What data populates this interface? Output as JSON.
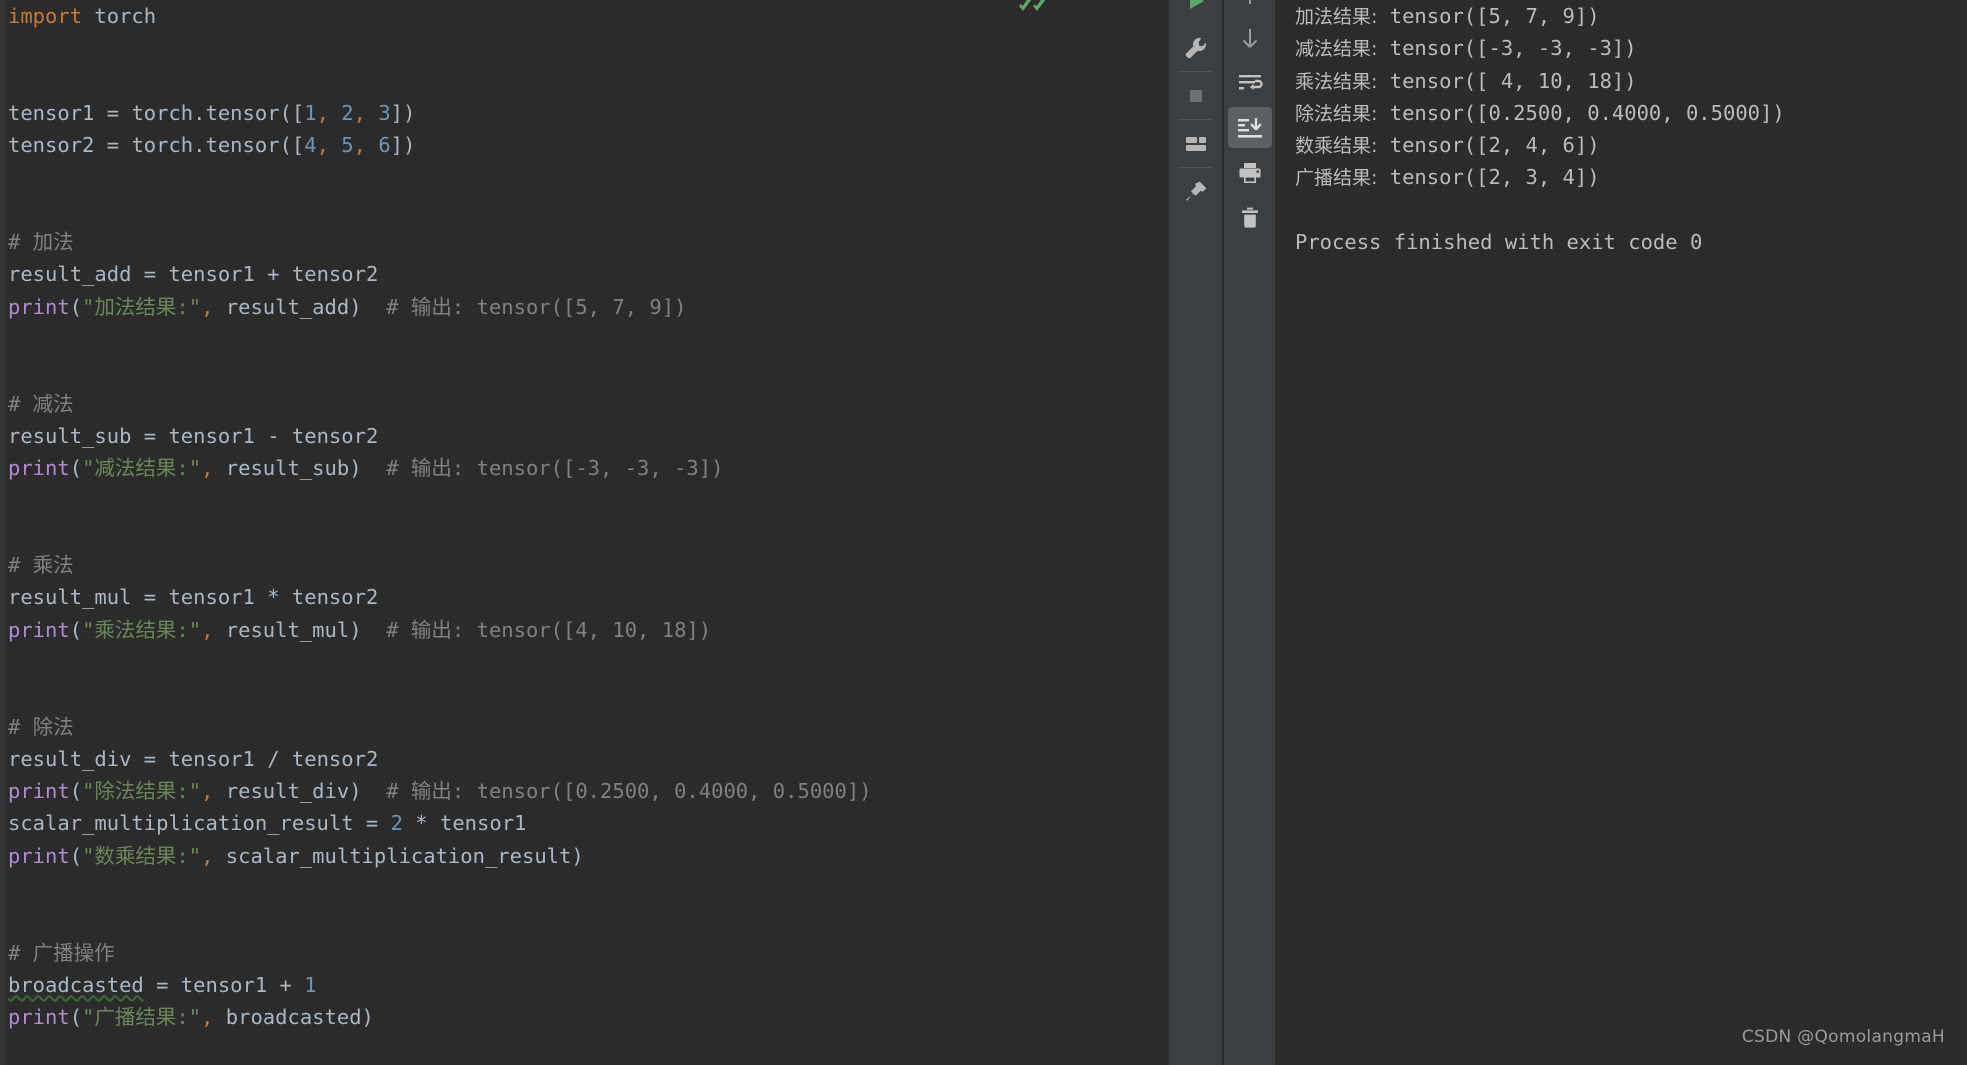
{
  "app": {
    "name": "PyCharm",
    "theme_colors": {
      "editor_background": "#2B2B2B",
      "gutter": "#313335",
      "toolbar_background": "#3C3F41",
      "scrollbar_thumb": "#595959",
      "keyword": "#CC7832",
      "identifier": "#A9B7C6",
      "number": "#6897BB",
      "string": "#6A8759",
      "comment": "#808080",
      "function": "#B389D4",
      "console_text": "#BBBBBB",
      "typo_underline": "#3A6B35",
      "run_green": "#59A869",
      "active_button": "#5B6064"
    }
  },
  "editor": {
    "language": "Python",
    "inspection_status": "ok",
    "lines": [
      [
        {
          "t": "import ",
          "c": "kw"
        },
        {
          "t": "torch",
          "c": "id"
        }
      ],
      [],
      [],
      [
        {
          "t": "tensor1 ",
          "c": "id"
        },
        {
          "t": "= ",
          "c": "pn"
        },
        {
          "t": "torch",
          "c": "id"
        },
        {
          "t": ".",
          "c": "pn"
        },
        {
          "t": "tensor",
          "c": "id"
        },
        {
          "t": "([",
          "c": "pn"
        },
        {
          "t": "1",
          "c": "num"
        },
        {
          "t": ",",
          "c": "cm"
        },
        {
          "t": " ",
          "c": "pn"
        },
        {
          "t": "2",
          "c": "num"
        },
        {
          "t": ",",
          "c": "cm"
        },
        {
          "t": " ",
          "c": "pn"
        },
        {
          "t": "3",
          "c": "num"
        },
        {
          "t": "])",
          "c": "pn"
        }
      ],
      [
        {
          "t": "tensor2 ",
          "c": "id"
        },
        {
          "t": "= ",
          "c": "pn"
        },
        {
          "t": "torch",
          "c": "id"
        },
        {
          "t": ".",
          "c": "pn"
        },
        {
          "t": "tensor",
          "c": "id"
        },
        {
          "t": "([",
          "c": "pn"
        },
        {
          "t": "4",
          "c": "num"
        },
        {
          "t": ",",
          "c": "cm"
        },
        {
          "t": " ",
          "c": "pn"
        },
        {
          "t": "5",
          "c": "num"
        },
        {
          "t": ",",
          "c": "cm"
        },
        {
          "t": " ",
          "c": "pn"
        },
        {
          "t": "6",
          "c": "num"
        },
        {
          "t": "])",
          "c": "pn"
        }
      ],
      [],
      [],
      [
        {
          "t": "# 加法",
          "c": "cmt"
        }
      ],
      [
        {
          "t": "result_add ",
          "c": "id"
        },
        {
          "t": "= ",
          "c": "pn"
        },
        {
          "t": "tensor1 ",
          "c": "id"
        },
        {
          "t": "+ ",
          "c": "pn"
        },
        {
          "t": "tensor2",
          "c": "id"
        }
      ],
      [
        {
          "t": "print",
          "c": "fn"
        },
        {
          "t": "(",
          "c": "pn"
        },
        {
          "t": "\"加法结果:\"",
          "c": "str"
        },
        {
          "t": ",",
          "c": "cm"
        },
        {
          "t": " result_add",
          "c": "id"
        },
        {
          "t": ")",
          "c": "pn"
        },
        {
          "t": "  # 输出: tensor([5, 7, 9])",
          "c": "cmt"
        }
      ],
      [],
      [],
      [
        {
          "t": "# 减法",
          "c": "cmt"
        }
      ],
      [
        {
          "t": "result_sub ",
          "c": "id"
        },
        {
          "t": "= ",
          "c": "pn"
        },
        {
          "t": "tensor1 ",
          "c": "id"
        },
        {
          "t": "- ",
          "c": "pn"
        },
        {
          "t": "tensor2",
          "c": "id"
        }
      ],
      [
        {
          "t": "print",
          "c": "fn"
        },
        {
          "t": "(",
          "c": "pn"
        },
        {
          "t": "\"减法结果:\"",
          "c": "str"
        },
        {
          "t": ",",
          "c": "cm"
        },
        {
          "t": " result_sub",
          "c": "id"
        },
        {
          "t": ")",
          "c": "pn"
        },
        {
          "t": "  # 输出: tensor([-3, -3, -3])",
          "c": "cmt"
        }
      ],
      [],
      [],
      [
        {
          "t": "# 乘法",
          "c": "cmt"
        }
      ],
      [
        {
          "t": "result_mul ",
          "c": "id"
        },
        {
          "t": "= ",
          "c": "pn"
        },
        {
          "t": "tensor1 ",
          "c": "id"
        },
        {
          "t": "* ",
          "c": "pn"
        },
        {
          "t": "tensor2",
          "c": "id"
        }
      ],
      [
        {
          "t": "print",
          "c": "fn"
        },
        {
          "t": "(",
          "c": "pn"
        },
        {
          "t": "\"乘法结果:\"",
          "c": "str"
        },
        {
          "t": ",",
          "c": "cm"
        },
        {
          "t": " result_mul",
          "c": "id"
        },
        {
          "t": ")",
          "c": "pn"
        },
        {
          "t": "  # 输出: tensor([4, 10, 18])",
          "c": "cmt"
        }
      ],
      [],
      [],
      [
        {
          "t": "# 除法",
          "c": "cmt"
        }
      ],
      [
        {
          "t": "result_div ",
          "c": "id"
        },
        {
          "t": "= ",
          "c": "pn"
        },
        {
          "t": "tensor1 ",
          "c": "id"
        },
        {
          "t": "/ ",
          "c": "pn"
        },
        {
          "t": "tensor2",
          "c": "id"
        }
      ],
      [
        {
          "t": "print",
          "c": "fn"
        },
        {
          "t": "(",
          "c": "pn"
        },
        {
          "t": "\"除法结果:\"",
          "c": "str"
        },
        {
          "t": ",",
          "c": "cm"
        },
        {
          "t": " result_div",
          "c": "id"
        },
        {
          "t": ")",
          "c": "pn"
        },
        {
          "t": "  # 输出: tensor([0.2500, 0.4000, 0.5000])",
          "c": "cmt"
        }
      ],
      [
        {
          "t": "scalar_multiplication_result ",
          "c": "id"
        },
        {
          "t": "= ",
          "c": "pn"
        },
        {
          "t": "2",
          "c": "num"
        },
        {
          "t": " * ",
          "c": "pn"
        },
        {
          "t": "tensor1",
          "c": "id"
        }
      ],
      [
        {
          "t": "print",
          "c": "fn"
        },
        {
          "t": "(",
          "c": "pn"
        },
        {
          "t": "\"数乘结果:\"",
          "c": "str"
        },
        {
          "t": ",",
          "c": "cm"
        },
        {
          "t": " scalar_multiplication_result",
          "c": "id"
        },
        {
          "t": ")",
          "c": "pn"
        }
      ],
      [],
      [],
      [
        {
          "t": "# 广播操作",
          "c": "cmt"
        }
      ],
      [
        {
          "t": "broadcasted",
          "c": "typo"
        },
        {
          "t": " = ",
          "c": "pn"
        },
        {
          "t": "tensor1 ",
          "c": "id"
        },
        {
          "t": "+ ",
          "c": "pn"
        },
        {
          "t": "1",
          "c": "num"
        }
      ],
      [
        {
          "t": "print",
          "c": "fn"
        },
        {
          "t": "(",
          "c": "pn"
        },
        {
          "t": "\"广播结果:\"",
          "c": "str"
        },
        {
          "t": ",",
          "c": "cm"
        },
        {
          "t": " broadcasted",
          "c": "id"
        },
        {
          "t": ")",
          "c": "pn"
        }
      ]
    ]
  },
  "toolbar_left": {
    "items": [
      {
        "name": "rerun-button",
        "icon": "play-icon",
        "label": "Rerun",
        "sep_after": false
      },
      {
        "name": "settings-button",
        "icon": "wrench-icon",
        "label": "Settings",
        "sep_after": true
      },
      {
        "name": "stop-button",
        "icon": "stop-icon",
        "label": "Stop",
        "sep_after": true
      },
      {
        "name": "layout-button",
        "icon": "layout-icon",
        "label": "Layout Settings",
        "sep_after": true
      },
      {
        "name": "pin-tab-button",
        "icon": "pin-icon",
        "label": "Pin Tab",
        "sep_after": false
      }
    ]
  },
  "toolbar_right": {
    "items": [
      {
        "name": "scroll-up-button",
        "icon": "arrow-up-icon",
        "label": "Up the Stack Trace",
        "active": false
      },
      {
        "name": "scroll-down-button",
        "icon": "arrow-down-icon",
        "label": "Down the Stack Trace",
        "active": false
      },
      {
        "name": "soft-wrap-button",
        "icon": "soft-wrap-icon",
        "label": "Use Soft Wraps",
        "active": false
      },
      {
        "name": "scroll-to-end-button",
        "icon": "scroll-to-end-icon",
        "label": "Scroll to the end",
        "active": true
      },
      {
        "name": "print-button",
        "icon": "print-icon",
        "label": "Print",
        "active": false
      },
      {
        "name": "clear-all-button",
        "icon": "trash-icon",
        "label": "Clear All",
        "active": false
      }
    ]
  },
  "console": {
    "lines": [
      {
        "cjk": "加法结果:",
        "mono": " tensor([5, 7, 9])"
      },
      {
        "cjk": "减法结果:",
        "mono": " tensor([-3, -3, -3])"
      },
      {
        "cjk": "乘法结果:",
        "mono": " tensor([ 4, 10, 18])"
      },
      {
        "cjk": "除法结果:",
        "mono": " tensor([0.2500, 0.4000, 0.5000])"
      },
      {
        "cjk": "数乘结果:",
        "mono": " tensor([2, 4, 6])"
      },
      {
        "cjk": "广播结果:",
        "mono": " tensor([2, 3, 4])"
      }
    ],
    "blank_after": 1,
    "exit_message": "Process finished with exit code 0"
  },
  "watermark": {
    "text": "CSDN @QomolangmaH"
  }
}
